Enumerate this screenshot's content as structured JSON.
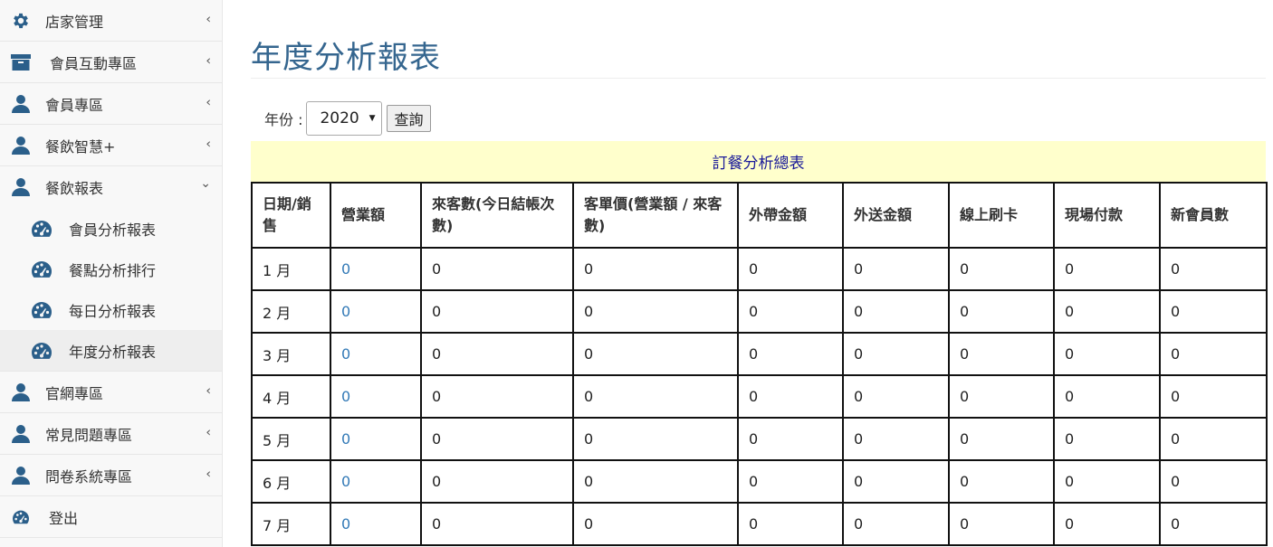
{
  "sidebar": {
    "items": [
      {
        "label": "店家管理",
        "icon": "gear-icon",
        "chevron": "‹"
      },
      {
        "label": "會員互動專區",
        "icon": "archive-box-icon",
        "chevron": "‹"
      },
      {
        "label": "會員專區",
        "icon": "user-icon",
        "chevron": "‹"
      },
      {
        "label": "餐飲智慧+",
        "icon": "user-icon",
        "chevron": "‹"
      }
    ],
    "report_section": {
      "label": "餐飲報表",
      "icon": "user-icon",
      "chevron": "⌄",
      "children": [
        {
          "label": "會員分析報表",
          "icon": "dashboard-icon"
        },
        {
          "label": "餐點分析排行",
          "icon": "dashboard-icon"
        },
        {
          "label": "每日分析報表",
          "icon": "dashboard-icon"
        },
        {
          "label": "年度分析報表",
          "icon": "dashboard-icon",
          "active": true
        }
      ]
    },
    "items_after": [
      {
        "label": "官網專區",
        "icon": "user-icon",
        "chevron": "‹"
      },
      {
        "label": "常見問題專區",
        "icon": "user-icon",
        "chevron": "‹"
      },
      {
        "label": "問卷系統專區",
        "icon": "user-icon",
        "chevron": "‹"
      }
    ],
    "logout": {
      "label": "登出",
      "icon": "dashboard-icon"
    }
  },
  "main": {
    "title": "年度分析報表",
    "filter": {
      "year_label": "年份 :",
      "year_value": "2020",
      "query_button": "查詢"
    },
    "table_caption": "訂餐分析總表",
    "table": {
      "headers": [
        "日期/銷售",
        "營業額",
        "來客數(今日結帳次數)",
        "客單價(營業額 / 來客數)",
        "外帶金額",
        "外送金額",
        "線上刷卡",
        "現場付款",
        "新會員數"
      ],
      "rows": [
        [
          "1 月",
          "0",
          "0",
          "0",
          "0",
          "0",
          "0",
          "0",
          "0"
        ],
        [
          "2 月",
          "0",
          "0",
          "0",
          "0",
          "0",
          "0",
          "0",
          "0"
        ],
        [
          "3 月",
          "0",
          "0",
          "0",
          "0",
          "0",
          "0",
          "0",
          "0"
        ],
        [
          "4 月",
          "0",
          "0",
          "0",
          "0",
          "0",
          "0",
          "0",
          "0"
        ],
        [
          "5 月",
          "0",
          "0",
          "0",
          "0",
          "0",
          "0",
          "0",
          "0"
        ],
        [
          "6 月",
          "0",
          "0",
          "0",
          "0",
          "0",
          "0",
          "0",
          "0"
        ],
        [
          "7 月",
          "0",
          "0",
          "0",
          "0",
          "0",
          "0",
          "0",
          "0"
        ]
      ]
    }
  },
  "colors": {
    "title": "#35668f",
    "icon": "#2b5f8a",
    "link": "#337ab7",
    "caption_bg": "#ffffcc",
    "caption_text": "#1a1a99"
  }
}
